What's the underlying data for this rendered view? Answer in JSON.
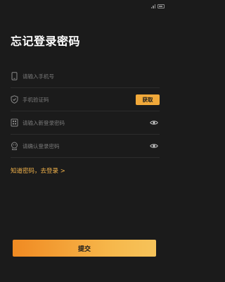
{
  "page": {
    "title": "忘记登录密码"
  },
  "form": {
    "phone": {
      "placeholder": "请输入手机号",
      "value": ""
    },
    "code": {
      "placeholder": "手机验证码",
      "value": "",
      "button_label": "获取"
    },
    "new_password": {
      "placeholder": "请输入新登录密码",
      "value": ""
    },
    "confirm_password": {
      "placeholder": "请确认登录密码",
      "value": ""
    }
  },
  "links": {
    "login": "知道密码，去登录 >"
  },
  "actions": {
    "submit_label": "提交"
  },
  "colors": {
    "background": "#1b1b1b",
    "accent": "#f1a93a",
    "link": "#f2b24a",
    "divider": "#2c2c2c"
  },
  "icons": [
    "phone-icon",
    "shield-icon",
    "lock-icon",
    "user-lock-icon",
    "eye-icon"
  ]
}
